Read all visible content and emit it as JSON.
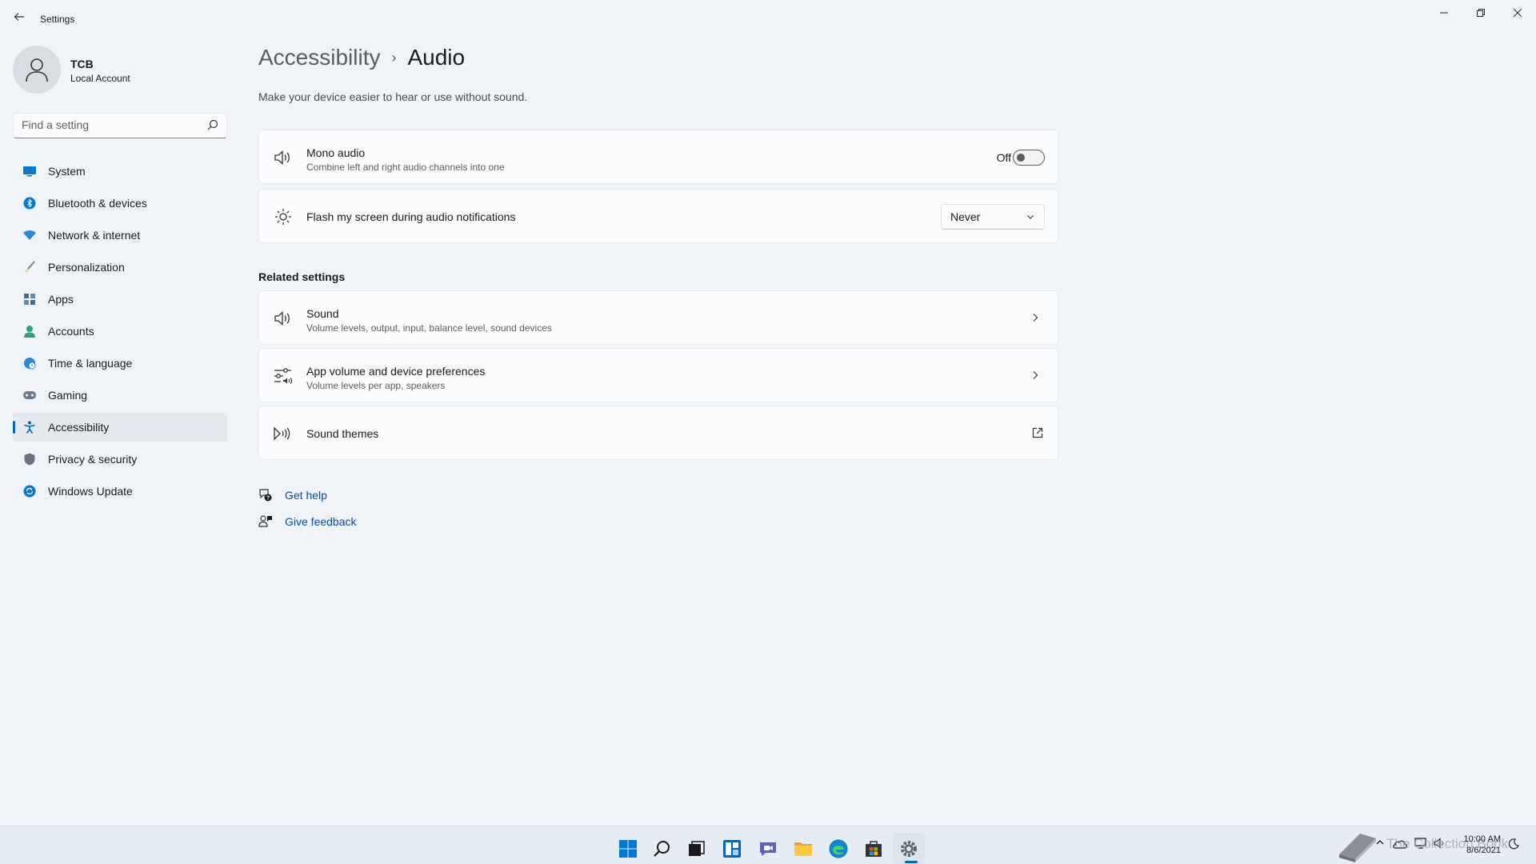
{
  "window": {
    "title": "Settings",
    "back_glyph": "←",
    "minimize_glyph": "—",
    "restore_glyph": "❐",
    "close_glyph": "✕"
  },
  "profile": {
    "name": "TCB",
    "account_type": "Local Account"
  },
  "search": {
    "placeholder": "Find a setting",
    "value": ""
  },
  "sidebar": {
    "items": [
      {
        "label": "System",
        "icon": "monitor-icon",
        "active": false
      },
      {
        "label": "Bluetooth & devices",
        "icon": "bluetooth-icon",
        "active": false
      },
      {
        "label": "Network & internet",
        "icon": "wifi-icon",
        "active": false
      },
      {
        "label": "Personalization",
        "icon": "brush-icon",
        "active": false
      },
      {
        "label": "Apps",
        "icon": "apps-icon",
        "active": false
      },
      {
        "label": "Accounts",
        "icon": "person-icon",
        "active": false
      },
      {
        "label": "Time & language",
        "icon": "globe-clock-icon",
        "active": false
      },
      {
        "label": "Gaming",
        "icon": "gamepad-icon",
        "active": false
      },
      {
        "label": "Accessibility",
        "icon": "accessibility-icon",
        "active": true
      },
      {
        "label": "Privacy & security",
        "icon": "shield-icon",
        "active": false
      },
      {
        "label": "Windows Update",
        "icon": "update-icon",
        "active": false
      }
    ]
  },
  "main": {
    "breadcrumb_parent": "Accessibility",
    "breadcrumb_separator": "›",
    "breadcrumb_current": "Audio",
    "description": "Make your device easier to hear or use without sound.",
    "mono_audio": {
      "title": "Mono audio",
      "subtitle": "Combine left and right audio channels into one",
      "state_label": "Off",
      "on": false
    },
    "flash_screen": {
      "title": "Flash my screen during audio notifications",
      "selected": "Never"
    },
    "related_label": "Related settings",
    "related": [
      {
        "title": "Sound",
        "subtitle": "Volume levels, output, input, balance level, sound devices"
      },
      {
        "title": "App volume and device preferences",
        "subtitle": "Volume levels per app, speakers"
      },
      {
        "title": "Sound themes",
        "subtitle": ""
      }
    ],
    "get_help": "Get help",
    "give_feedback": "Give feedback"
  },
  "taskbar": {
    "apps": [
      "start-icon",
      "search-icon",
      "task-view-icon",
      "widgets-icon",
      "chat-icon",
      "file-explorer-icon",
      "edge-icon",
      "store-icon",
      "settings-icon"
    ],
    "active_app": "settings-icon"
  },
  "tray": {
    "time": "10:00 AM",
    "date": "8/6/2021",
    "overflow_glyph": "^",
    "watermark_text": "The Collection Book"
  },
  "colors": {
    "accent": "#0067c0",
    "background": "#f0f4f9",
    "card": "#fbfcfd"
  }
}
